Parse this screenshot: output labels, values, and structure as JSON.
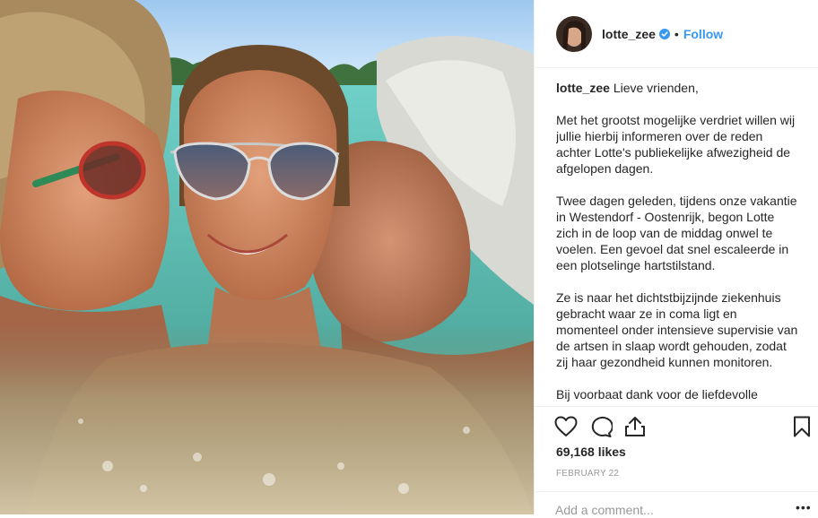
{
  "post": {
    "image_alt": "Three people smiling in turquoise sea water",
    "header": {
      "username": "lotte_zee",
      "verified": true,
      "separator": "•",
      "follow_label": "Follow"
    },
    "caption": {
      "username": "lotte_zee",
      "greeting": "Lieve vrienden,",
      "paragraphs": [
        "Met het grootst mogelijke verdriet willen wij jullie hierbij informeren over de reden achter Lotte's publiekelijke afwezigheid de afgelopen dagen.",
        "Twee dagen geleden, tijdens onze vakantie in Westendorf - Oostenrijk, begon Lotte zich in de loop van de middag onwel te voelen. Een gevoel dat snel escaleerde in een plotselinge hartstilstand.",
        "Ze is naar het dichtstbijzijnde ziekenhuis gebracht waar ze in coma ligt en momenteel onder intensieve supervisie van de artsen in slaap wordt gehouden, zodat zij haar gezondheid kunnen monitoren.",
        "Bij voorbaat dank voor de liefdevolle"
      ]
    },
    "likes": "69,168 likes",
    "date": "FEBRUARY 22",
    "comment_placeholder": "Add a comment...",
    "more_options": "•••",
    "icons": {
      "like": "heart-icon",
      "comment": "comment-icon",
      "share": "share-icon",
      "save": "bookmark-icon",
      "verified": "verified-badge-icon"
    },
    "colors": {
      "follow": "#3897f0",
      "verified": "#3897f0",
      "meta": "#999999",
      "divider": "#efefef"
    }
  }
}
